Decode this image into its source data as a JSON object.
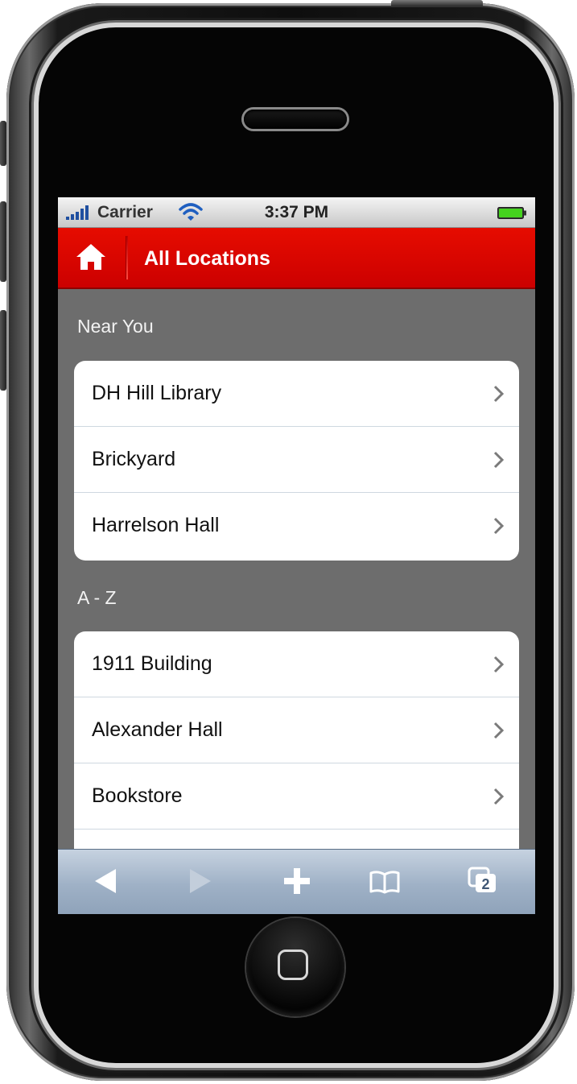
{
  "status_bar": {
    "carrier": "Carrier",
    "time": "3:37 PM"
  },
  "nav": {
    "title": "All Locations"
  },
  "sections": {
    "near": {
      "header": "Near You",
      "items": [
        {
          "label": "DH Hill Library"
        },
        {
          "label": "Brickyard"
        },
        {
          "label": "Harrelson Hall"
        }
      ]
    },
    "az": {
      "header": "A - Z",
      "items": [
        {
          "label": "1911 Building"
        },
        {
          "label": "Alexander Hall"
        },
        {
          "label": "Bookstore"
        },
        {
          "label": ""
        }
      ]
    }
  },
  "toolbar": {
    "pages_count": "2"
  },
  "colors": {
    "nav_red": "#d60a00",
    "page_bg": "#6d6d6d",
    "toolbar_blue": "#a3b4c8"
  },
  "icons": [
    "signal-icon",
    "wifi-icon",
    "battery-icon",
    "home-icon",
    "chevron-icon",
    "back-icon",
    "forward-icon",
    "add-icon",
    "bookmarks-icon",
    "pages-icon"
  ]
}
